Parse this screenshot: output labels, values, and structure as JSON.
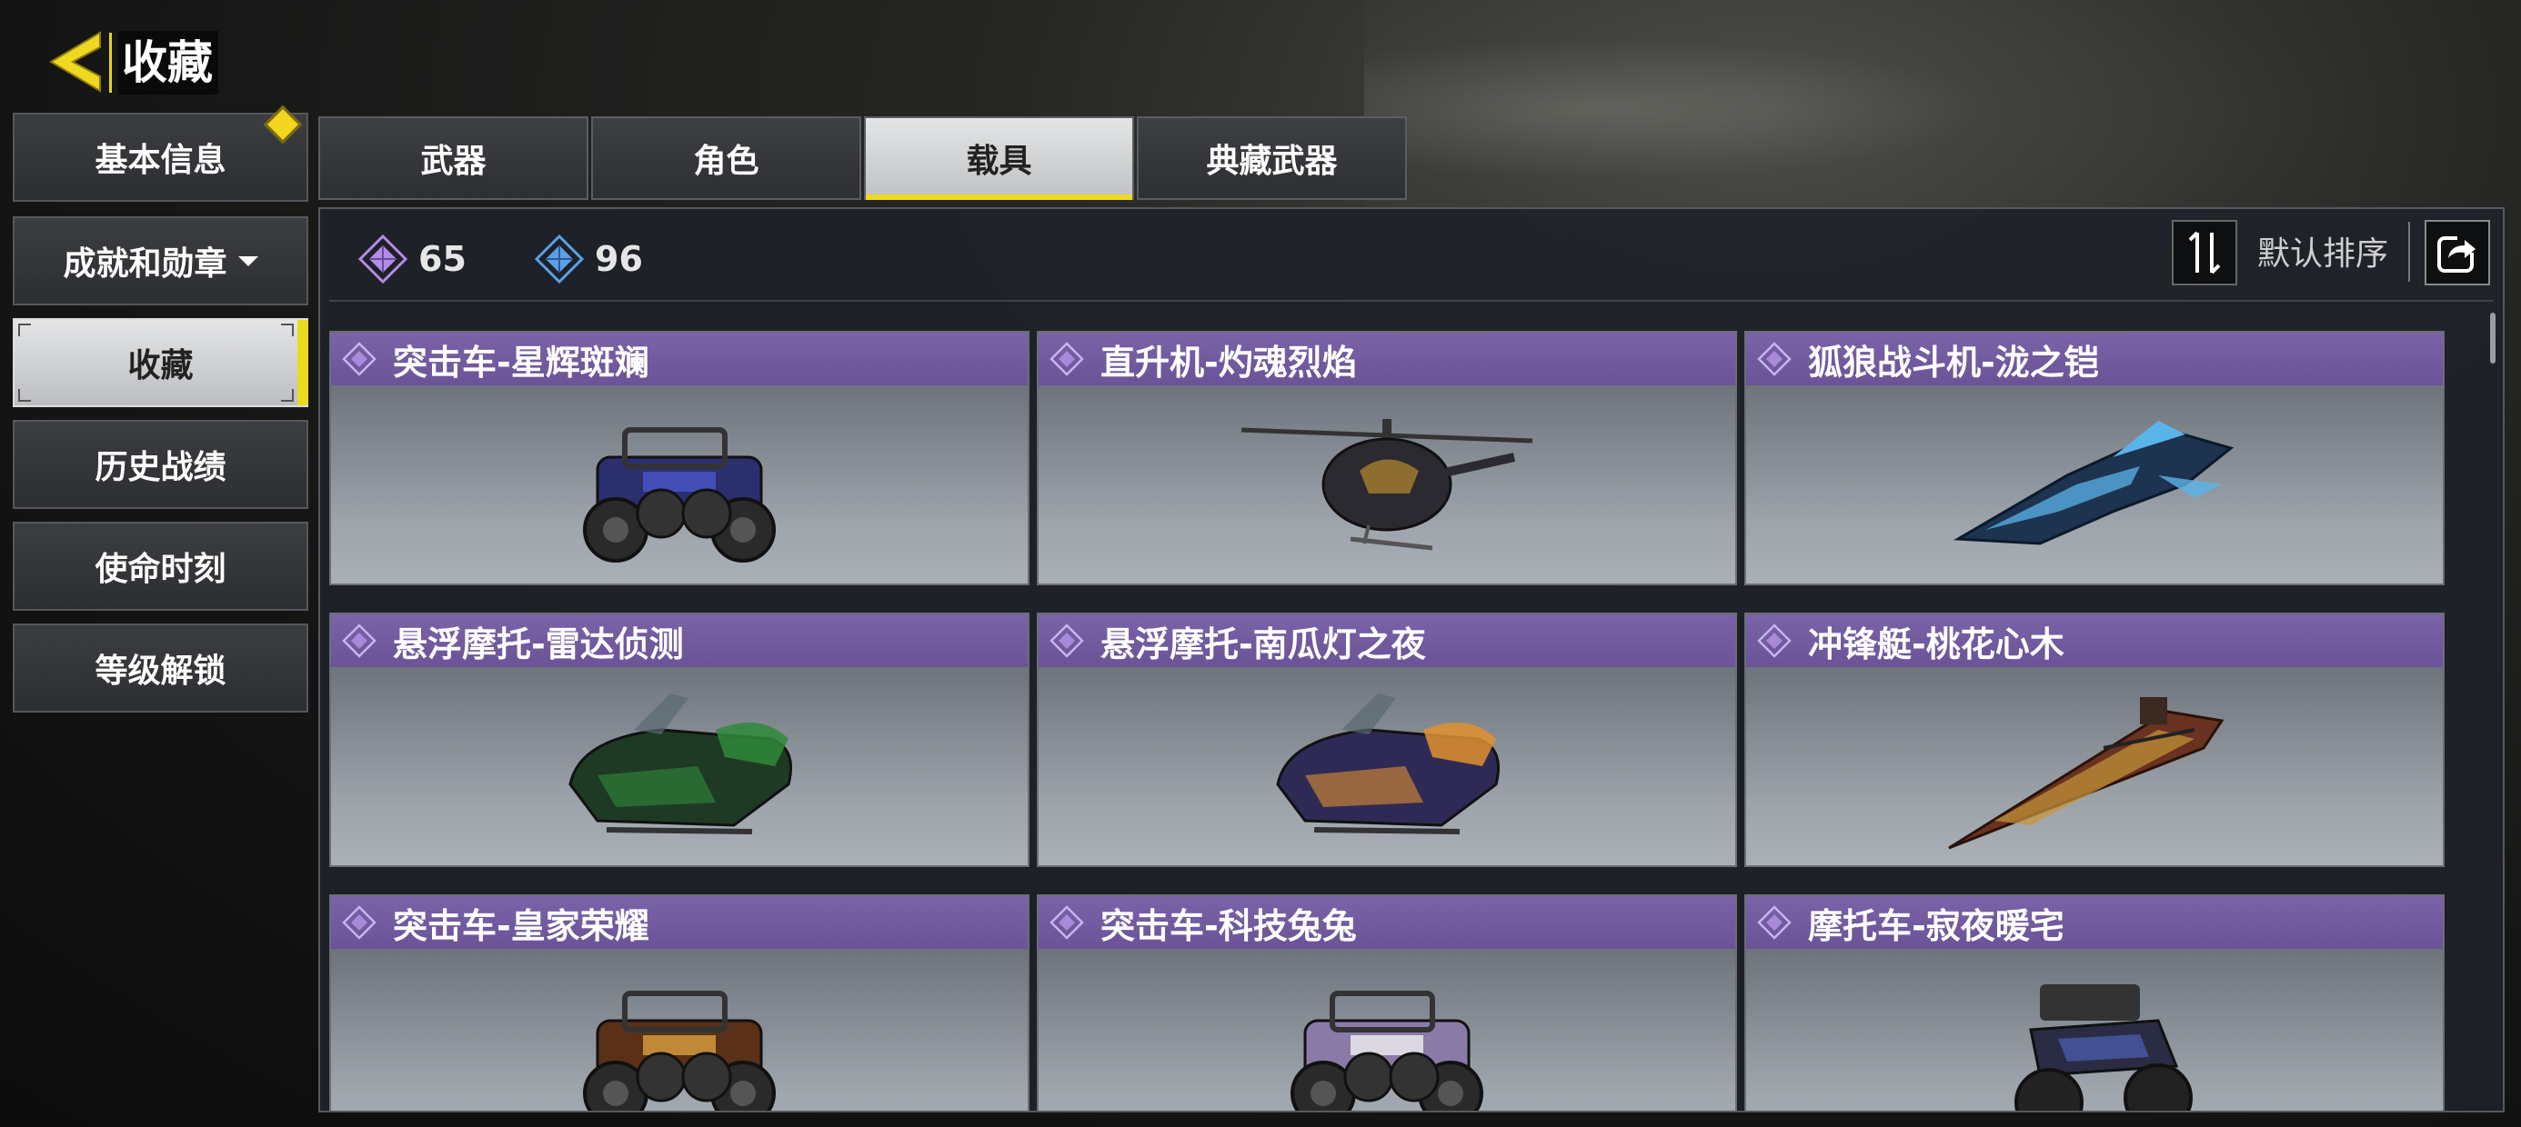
{
  "header": {
    "title": "收藏"
  },
  "sidebar": {
    "items": [
      {
        "label": "基本信息"
      },
      {
        "label": "成就和勋章"
      },
      {
        "label": "收藏"
      },
      {
        "label": "历史战绩"
      },
      {
        "label": "使命时刻"
      },
      {
        "label": "等级解锁"
      }
    ],
    "active": "收藏"
  },
  "tabs": [
    {
      "label": "武器"
    },
    {
      "label": "角色"
    },
    {
      "label": "载具"
    },
    {
      "label": "典藏武器"
    }
  ],
  "active_tab": "载具",
  "counters": [
    {
      "value": "65",
      "color": "#b28ce6",
      "icon": "purple-diamond-icon"
    },
    {
      "value": "96",
      "color": "#5aa0e6",
      "icon": "blue-diamond-icon"
    }
  ],
  "sort": {
    "label": "默认排序"
  },
  "items": [
    {
      "name": "突击车-星辉斑斓",
      "type": "buggy",
      "color": "#2b2f6e",
      "accent": "#4a58c8"
    },
    {
      "name": "直升机-灼魂烈焰",
      "type": "helicopter",
      "color": "#2a2a30",
      "accent": "#b88a30"
    },
    {
      "name": "狐狼战斗机-泷之铠",
      "type": "jet",
      "color": "#1d3350",
      "accent": "#5ab4ea"
    },
    {
      "name": "悬浮摩托-雷达侦测",
      "type": "hover",
      "color": "#1f3a24",
      "accent": "#2f8a3a"
    },
    {
      "name": "悬浮摩托-南瓜灯之夜",
      "type": "hover",
      "color": "#2e2a55",
      "accent": "#e09030"
    },
    {
      "name": "冲锋艇-桃花心木",
      "type": "boat",
      "color": "#6a3220",
      "accent": "#c8963a"
    },
    {
      "name": "突击车-皇家荣耀",
      "type": "buggy",
      "color": "#5a3018",
      "accent": "#d8a040"
    },
    {
      "name": "突击车-科技兔兔",
      "type": "buggy",
      "color": "#8a7aa8",
      "accent": "#f0f0f0"
    },
    {
      "name": "摩托车-寂夜暖宅",
      "type": "moto",
      "color": "#2a2c44",
      "accent": "#4a5aa8"
    }
  ],
  "colors": {
    "accent_yellow": "#efd820",
    "card_header_purple": "#6e58a0"
  }
}
